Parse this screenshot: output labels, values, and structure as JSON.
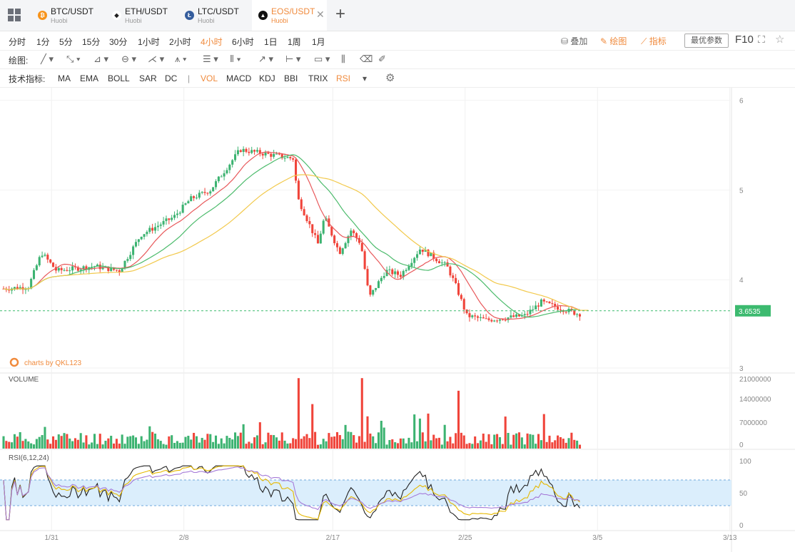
{
  "tabs": [
    {
      "pair": "BTC/USDT",
      "exchange": "Huobi",
      "coin": "btc-icon",
      "color": "#f7931a",
      "glyph": "₿",
      "active": false
    },
    {
      "pair": "ETH/USDT",
      "exchange": "Huobi",
      "coin": "eth-icon",
      "color": "#ffffff",
      "glyph": "◆",
      "active": false
    },
    {
      "pair": "LTC/USDT",
      "exchange": "Huobi",
      "coin": "ltc-icon",
      "color": "#345d9d",
      "glyph": "Ł",
      "active": false
    },
    {
      "pair": "EOS/USDT",
      "exchange": "Huobi",
      "coin": "eos-icon",
      "color": "#111111",
      "glyph": "▲",
      "active": true
    }
  ],
  "timeframes": [
    "分时",
    "1分",
    "5分",
    "15分",
    "30分",
    "1小时",
    "2小时",
    "4小时",
    "6小时",
    "1日",
    "1周",
    "1月"
  ],
  "active_timeframe": "4小时",
  "toolbar_right": {
    "overlay": "叠加",
    "draw": "绘图",
    "indicator": "指标",
    "optimal_params": "最优参数",
    "f10": "F10"
  },
  "draw_label": "绘图:",
  "indicators_label": "技术指标:",
  "indicators": [
    "MA",
    "EMA",
    "BOLL",
    "SAR",
    "DC",
    "|",
    "VOL",
    "MACD",
    "KDJ",
    "BBI",
    "TRIX",
    "RSI"
  ],
  "active_indicators": [
    "VOL",
    "RSI"
  ],
  "colors": {
    "up": "#3cb371",
    "down": "#f0443a",
    "ma1": "#e8585a",
    "ma2": "#4cbb6c",
    "ma3": "#f2c94c",
    "accent": "#f08a3c",
    "price_tag": "#3cba6f",
    "band": "#dbeefc"
  },
  "chart_data": {
    "type": "candlestick",
    "watermark": "charts by QKL123",
    "price_axis": {
      "ticks": [
        3,
        4,
        5,
        6
      ],
      "ylim": [
        3,
        6.1
      ]
    },
    "current_price": "3.6535",
    "x_ticks": [
      "1/31",
      "2/8",
      "2/17",
      "2/25",
      "3/5",
      "3/13"
    ],
    "volume": {
      "label": "VOLUME",
      "ticks": [
        "21000000",
        "14000000",
        "7000000",
        "0"
      ]
    },
    "rsi": {
      "label": "RSI(6,12,24)",
      "ticks": [
        "100",
        "50",
        "0"
      ],
      "bands": [
        70,
        30
      ]
    },
    "price_path": [
      [
        0,
        3.9
      ],
      [
        1.5,
        3.92
      ],
      [
        2.3,
        4.3
      ],
      [
        3.2,
        4.1
      ],
      [
        5.5,
        4.15
      ],
      [
        7,
        4.1
      ],
      [
        8.3,
        4.5
      ],
      [
        10.3,
        4.7
      ],
      [
        11.3,
        4.9
      ],
      [
        12.5,
        5
      ],
      [
        14.3,
        5.45
      ],
      [
        17.5,
        5.35
      ],
      [
        17.8,
        4.9
      ],
      [
        19,
        4.4
      ],
      [
        19.4,
        4.7
      ],
      [
        20.3,
        4.3
      ],
      [
        21,
        4.55
      ],
      [
        21.6,
        4.4
      ],
      [
        22.1,
        3.8
      ],
      [
        23.1,
        4.1
      ],
      [
        24,
        4.05
      ],
      [
        25.2,
        4.35
      ],
      [
        26.8,
        4.15
      ],
      [
        27.3,
        3.95
      ],
      [
        28,
        3.6
      ],
      [
        29.2,
        3.55
      ],
      [
        31.5,
        3.6
      ],
      [
        32.5,
        3.75
      ],
      [
        34.7,
        3.62
      ],
      [
        35,
        3.62
      ]
    ],
    "volume_spikes": [
      [
        17.8,
        0.95
      ],
      [
        18.7,
        0.6
      ],
      [
        21.6,
        0.95
      ],
      [
        26.7,
        0.32
      ],
      [
        27.5,
        0.78
      ]
    ],
    "days_shown": 35,
    "x_span_days": 44
  }
}
